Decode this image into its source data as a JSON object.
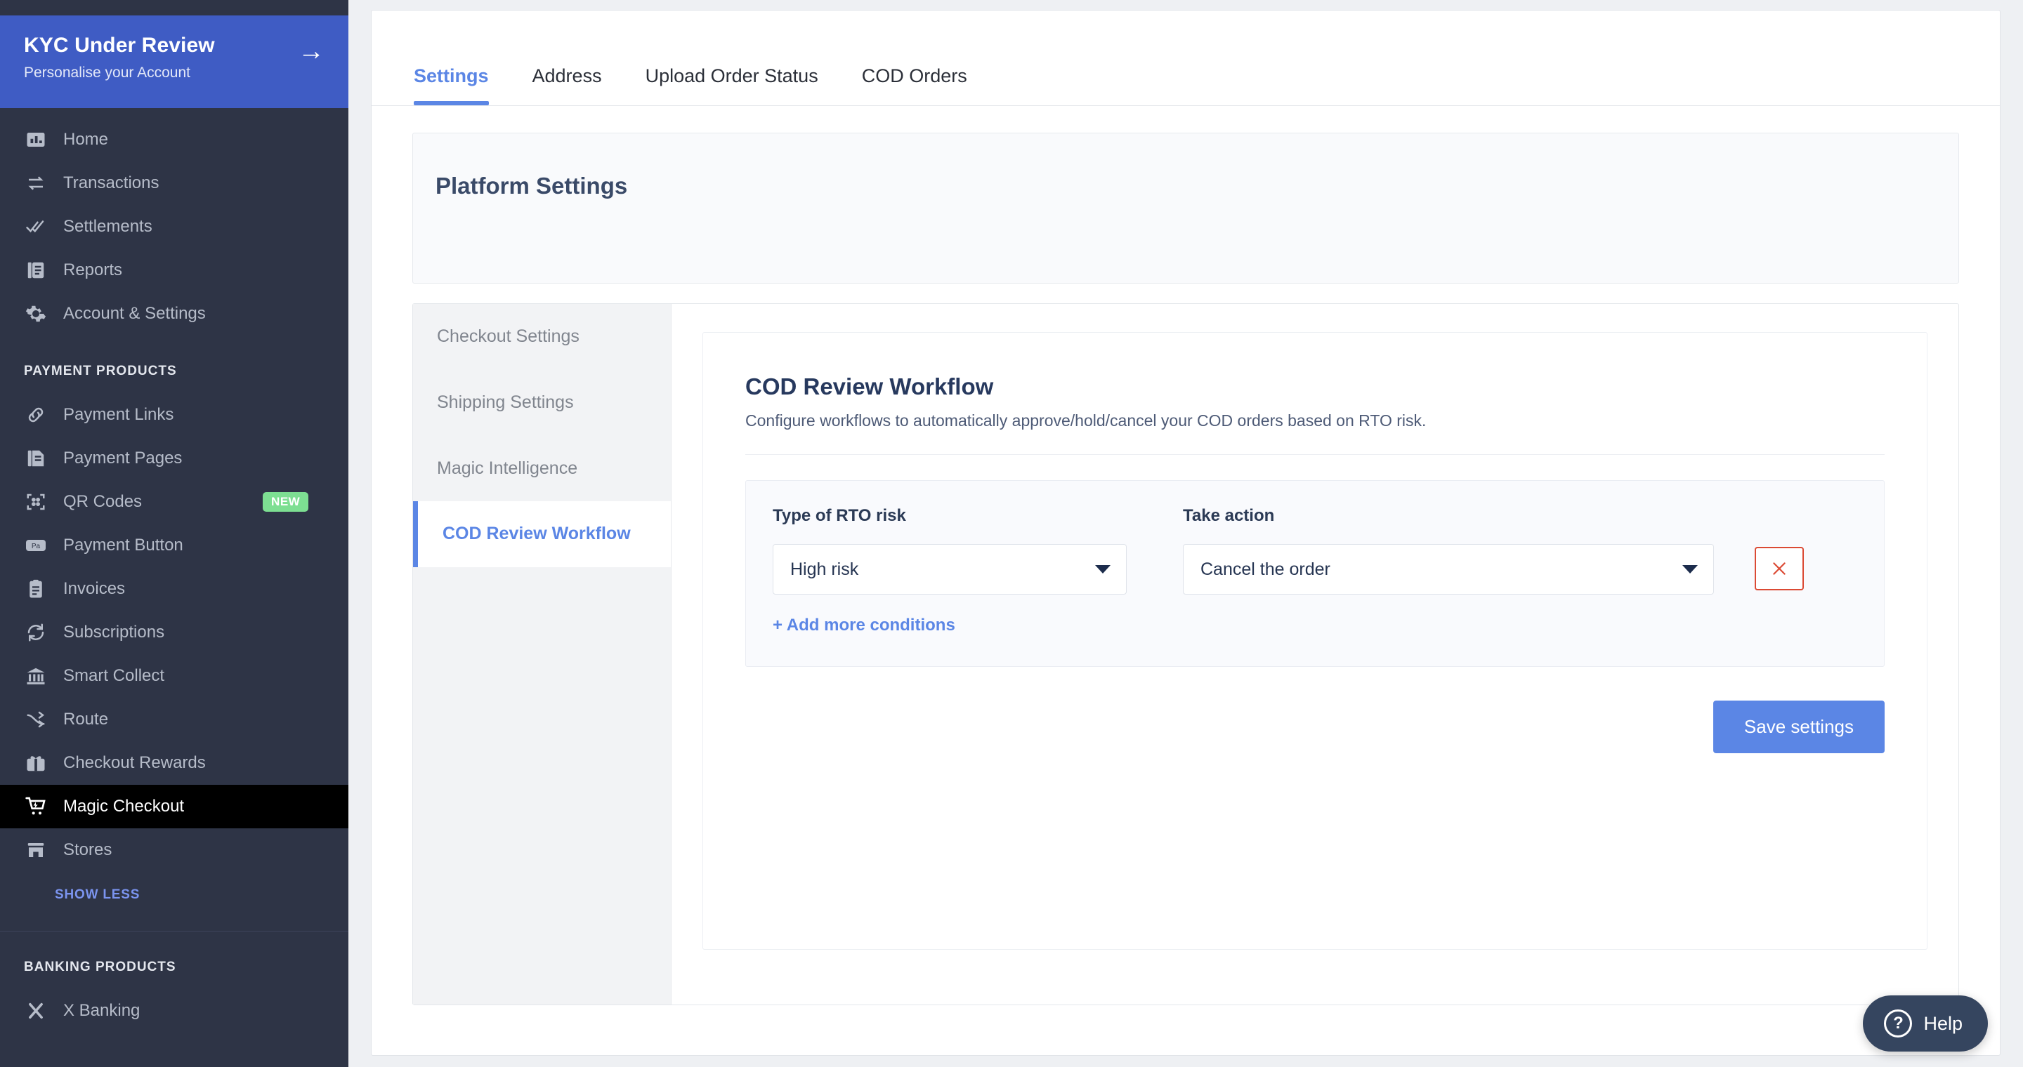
{
  "sidebar": {
    "kyc": {
      "title": "KYC Under Review",
      "subtitle": "Personalise your Account",
      "arrow": "→"
    },
    "primary_items": [
      {
        "label": "Home",
        "icon": "bar-chart-icon"
      },
      {
        "label": "Transactions",
        "icon": "transactions-swap-icon"
      },
      {
        "label": "Settlements",
        "icon": "double-check-icon"
      },
      {
        "label": "Reports",
        "icon": "reports-document-icon"
      },
      {
        "label": "Account & Settings",
        "icon": "gear-icon"
      }
    ],
    "payment_section_title": "PAYMENT PRODUCTS",
    "payment_items": [
      {
        "label": "Payment Links",
        "icon": "link-icon",
        "badge": ""
      },
      {
        "label": "Payment Pages",
        "icon": "page-icon",
        "badge": ""
      },
      {
        "label": "QR Codes",
        "icon": "qr-code-icon",
        "badge": "NEW"
      },
      {
        "label": "Payment Button",
        "icon": "payment-button-icon",
        "badge": ""
      },
      {
        "label": "Invoices",
        "icon": "invoice-clipboard-icon",
        "badge": ""
      },
      {
        "label": "Subscriptions",
        "icon": "refresh-cycle-icon",
        "badge": ""
      },
      {
        "label": "Smart Collect",
        "icon": "bank-icon",
        "badge": ""
      },
      {
        "label": "Route",
        "icon": "route-arrows-icon",
        "badge": ""
      },
      {
        "label": "Checkout Rewards",
        "icon": "gift-icon",
        "badge": ""
      },
      {
        "label": "Magic Checkout",
        "icon": "cart-bolt-icon",
        "badge": "",
        "active": true
      },
      {
        "label": "Stores",
        "icon": "store-icon",
        "badge": ""
      }
    ],
    "show_less": "SHOW LESS",
    "banking_section_title": "BANKING PRODUCTS",
    "banking_items": [
      {
        "label": "X Banking",
        "icon": "x-banking-icon"
      }
    ]
  },
  "tabs": [
    {
      "label": "Settings",
      "active": true
    },
    {
      "label": "Address",
      "active": false
    },
    {
      "label": "Upload Order Status",
      "active": false
    },
    {
      "label": "COD Orders",
      "active": false
    }
  ],
  "platform": {
    "title": "Platform Settings"
  },
  "subnav": [
    {
      "label": "Checkout Settings",
      "active": false
    },
    {
      "label": "Shipping Settings",
      "active": false
    },
    {
      "label": "Magic Intelligence",
      "active": false
    },
    {
      "label": "COD Review Workflow",
      "active": true
    }
  ],
  "workflow": {
    "title": "COD Review Workflow",
    "description": "Configure workflows to automatically approve/hold/cancel your COD orders based on RTO risk.",
    "risk_label": "Type of RTO risk",
    "risk_value": "High risk",
    "action_label": "Take action",
    "action_value": "Cancel the order",
    "delete_icon": "close-x-icon",
    "add_condition": "+ Add more conditions",
    "save_label": "Save settings"
  },
  "help": {
    "label": "Help",
    "icon": "question-mark-icon",
    "glyph": "?"
  },
  "colors": {
    "sidebar_bg": "#2e3446",
    "kyc_banner": "#3f5cc4",
    "accent_blue": "#5b86e5",
    "active_nav": "#000000",
    "badge_green": "#7ddf92",
    "danger_red": "#db4a34",
    "help_fab": "#35455f"
  }
}
